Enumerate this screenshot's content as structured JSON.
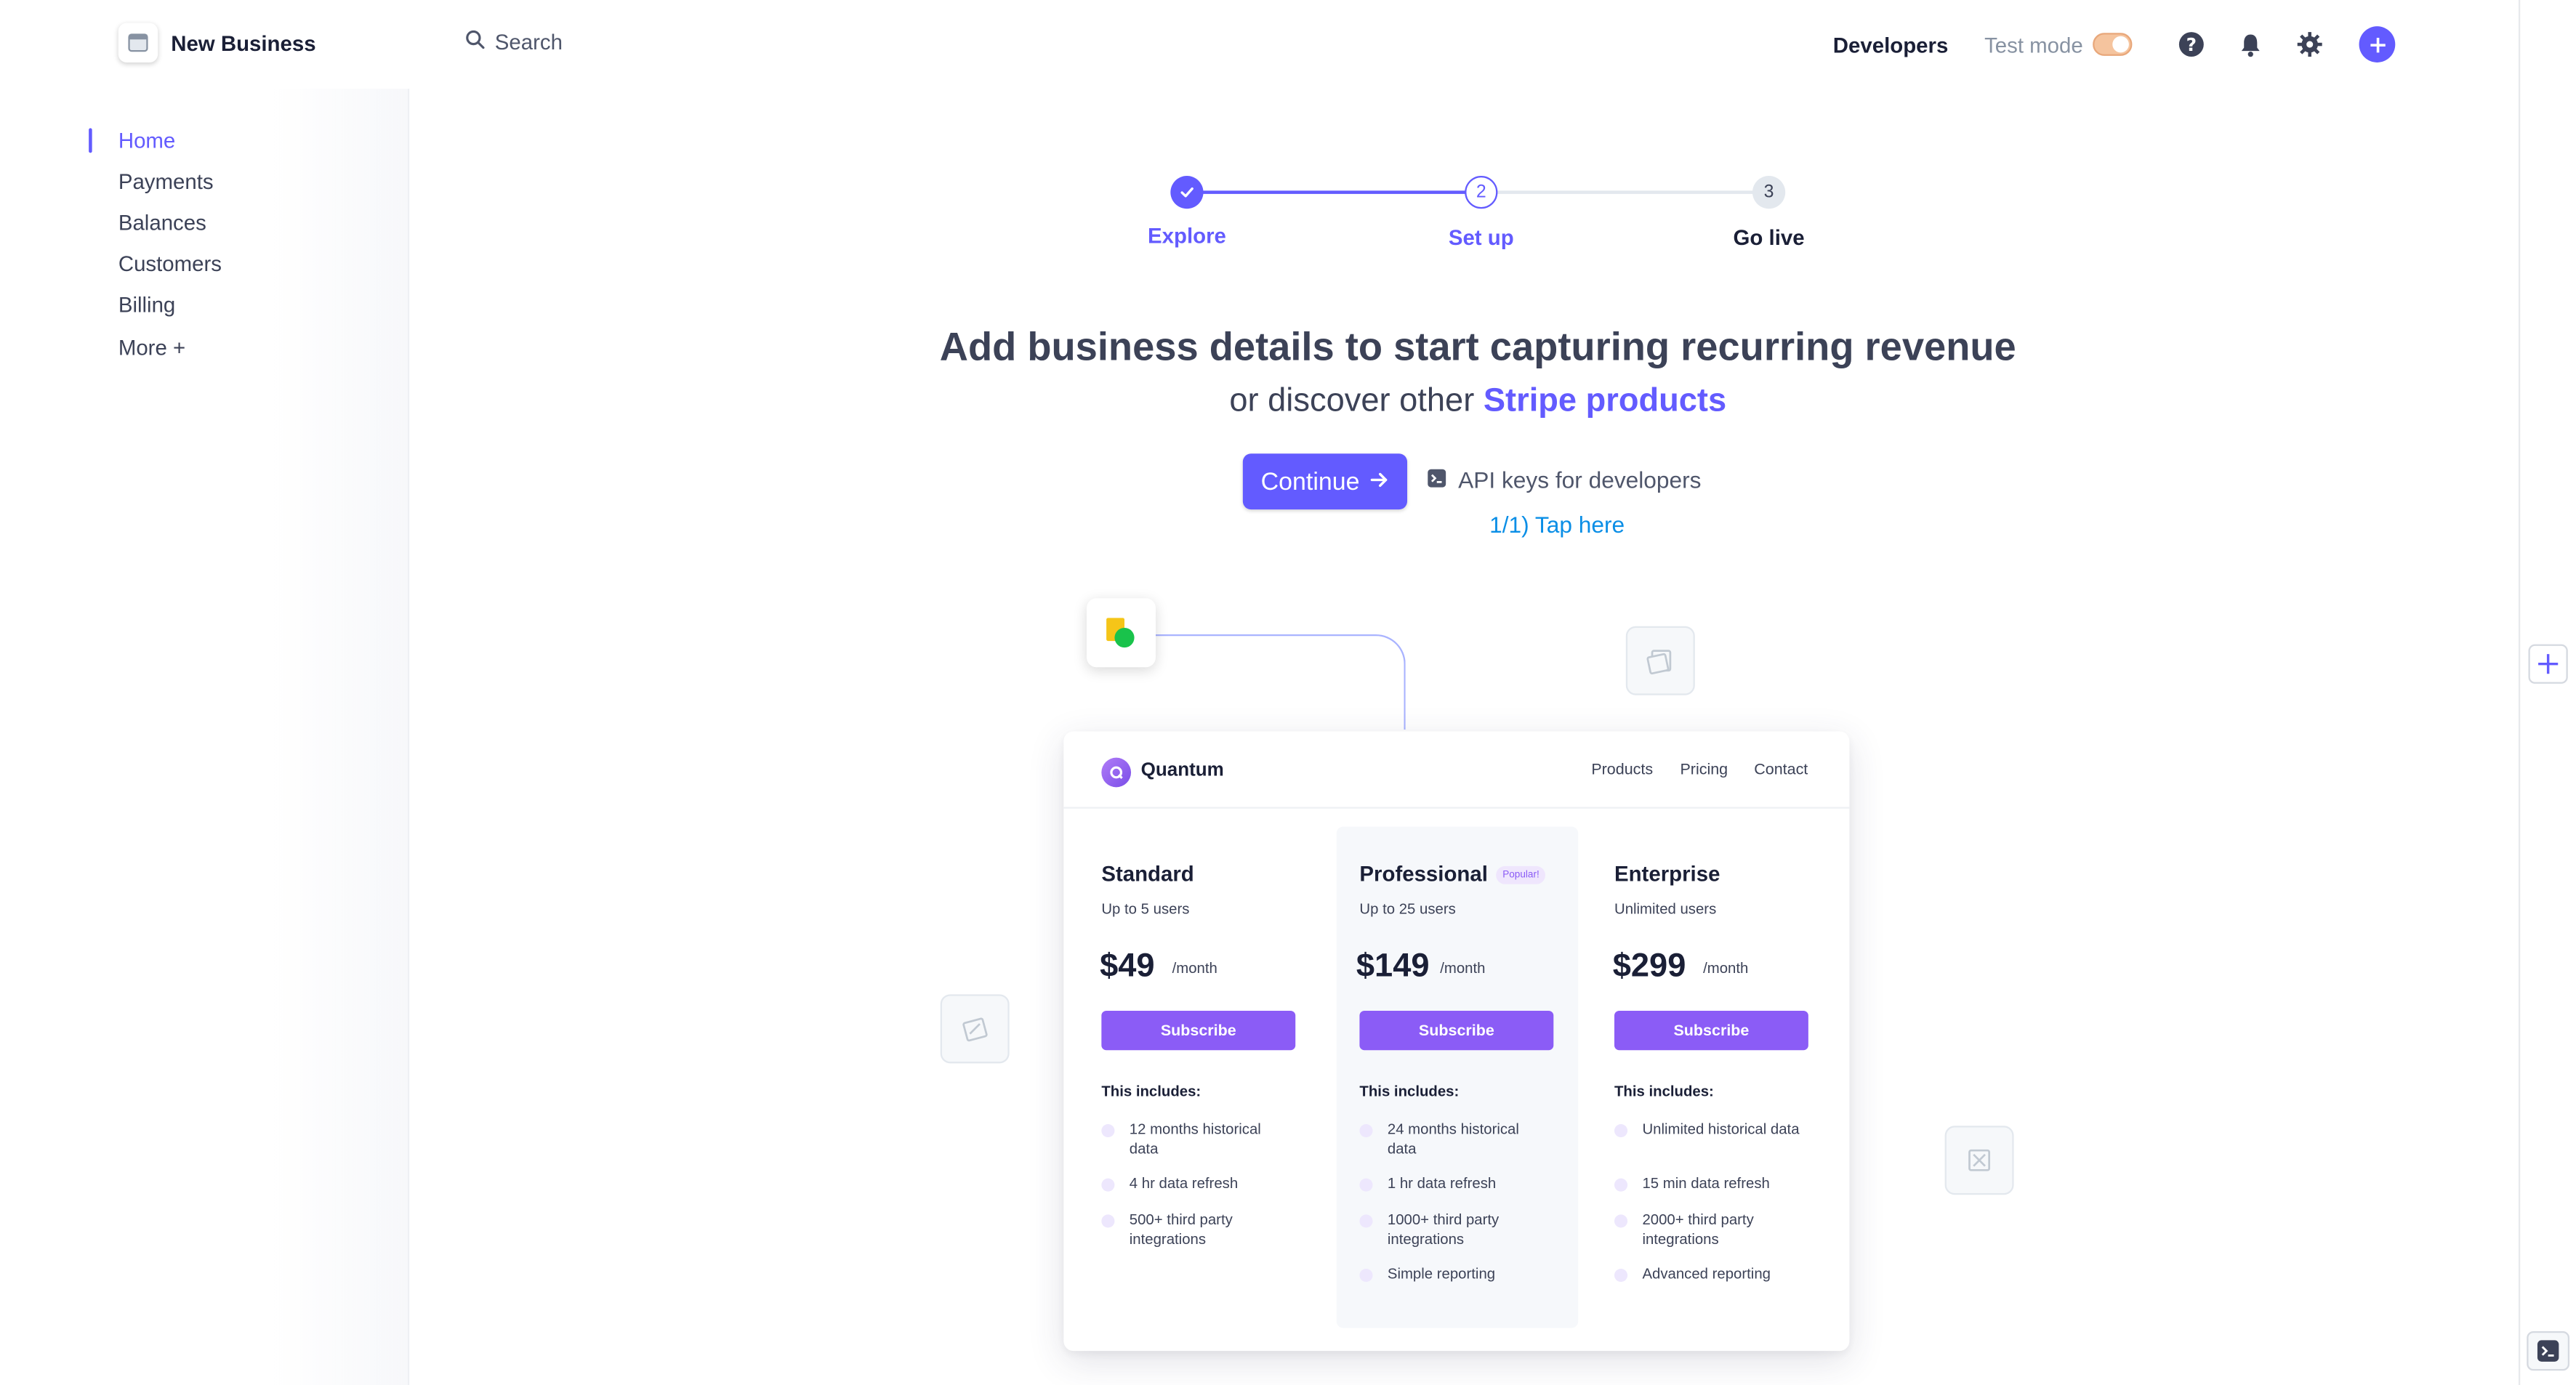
{
  "header": {
    "account_name": "New Business",
    "search_placeholder": "Search",
    "developers_label": "Developers",
    "test_mode_label": "Test mode",
    "test_mode_on": true
  },
  "sidebar": {
    "items": [
      {
        "label": "Home",
        "active": true
      },
      {
        "label": "Payments",
        "active": false
      },
      {
        "label": "Balances",
        "active": false
      },
      {
        "label": "Customers",
        "active": false
      },
      {
        "label": "Billing",
        "active": false
      },
      {
        "label": "More +",
        "active": false
      }
    ]
  },
  "stepper": {
    "steps": [
      {
        "number": "1",
        "label": "Explore",
        "state": "complete"
      },
      {
        "number": "2",
        "label": "Set up",
        "state": "current"
      },
      {
        "number": "3",
        "label": "Go live",
        "state": "upcoming"
      }
    ]
  },
  "hero": {
    "headline": "Add business details to start capturing recurring revenue",
    "subline_prefix": "or discover other",
    "subline_link": "Stripe products",
    "continue_label": "Continue",
    "api_keys_label": "API keys for developers",
    "tap_hint": "1/1) Tap here"
  },
  "pricing_preview": {
    "brand": "Quantum",
    "nav": [
      "Products",
      "Pricing",
      "Contact"
    ],
    "popular_badge": "Popular!",
    "includes_label": "This includes:",
    "plans": [
      {
        "name": "Standard",
        "users": "Up to 5 users",
        "price": "$49",
        "period": "/month",
        "cta": "Subscribe",
        "features": [
          "12 months historical data",
          "4 hr data refresh",
          "500+ third party integrations"
        ]
      },
      {
        "name": "Professional",
        "users": "Up to 25 users",
        "price": "$149",
        "period": "/month",
        "cta": "Subscribe",
        "features": [
          "24 months historical data",
          "1 hr data refresh",
          "1000+ third party integrations",
          "Simple reporting"
        ]
      },
      {
        "name": "Enterprise",
        "users": "Unlimited users",
        "price": "$299",
        "period": "/month",
        "cta": "Subscribe",
        "features": [
          "Unlimited historical data",
          "15 min data refresh",
          "2000+ third party integrations",
          "Advanced reporting"
        ]
      }
    ]
  },
  "icons": {
    "account": "storefront-icon",
    "search": "search-icon",
    "help": "help-circle-icon",
    "notifications": "bell-icon",
    "settings": "gear-icon",
    "create": "plus-circle-icon",
    "rail_add": "plus-icon",
    "rail_terminal": "terminal-icon"
  },
  "colors": {
    "accent": "#635bff",
    "pricing_accent": "#8b5cf6",
    "hint_link": "#0a8ee6",
    "test_mode_toggle": "#f5c49e"
  }
}
